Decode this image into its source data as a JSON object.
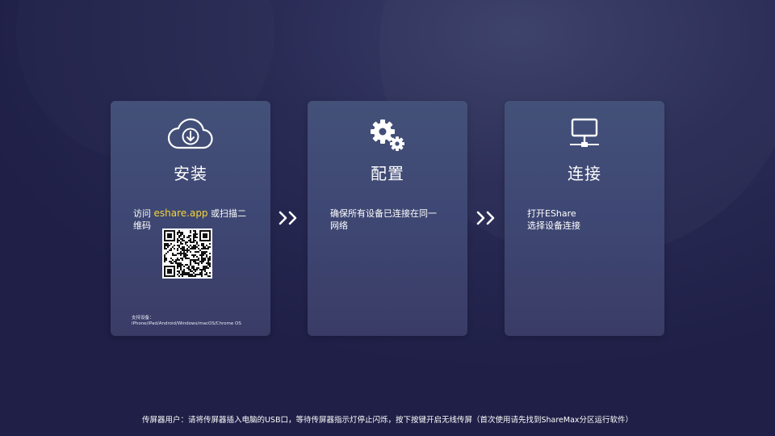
{
  "steps": [
    {
      "icon": "cloud-download-icon",
      "title": "安装",
      "desc_prefix": "访问 ",
      "desc_link": "eshare.app",
      "desc_suffix": " 或扫描二维码",
      "support_label": "支持设备：",
      "support_devices": "iPhone/iPad/Android/Windows/macOS/Chrome OS"
    },
    {
      "icon": "gears-icon",
      "title": "配置",
      "desc": "确保所有设备已连接在同一网络"
    },
    {
      "icon": "network-monitor-icon",
      "title": "连接",
      "desc_line1": "打开EShare",
      "desc_line2": "选择设备连接"
    }
  ],
  "separator_icon": "double-chevron-right-icon",
  "footer_text": "传屏器用户：请将传屏器插入电脑的USB口，等待传屏器指示灯停止闪烁，按下按键开启无线传屏（首次使用请先找到ShareMax分区运行软件）",
  "colors": {
    "link": "#f5d43a",
    "background": "#23244c",
    "card": "#404a74"
  }
}
